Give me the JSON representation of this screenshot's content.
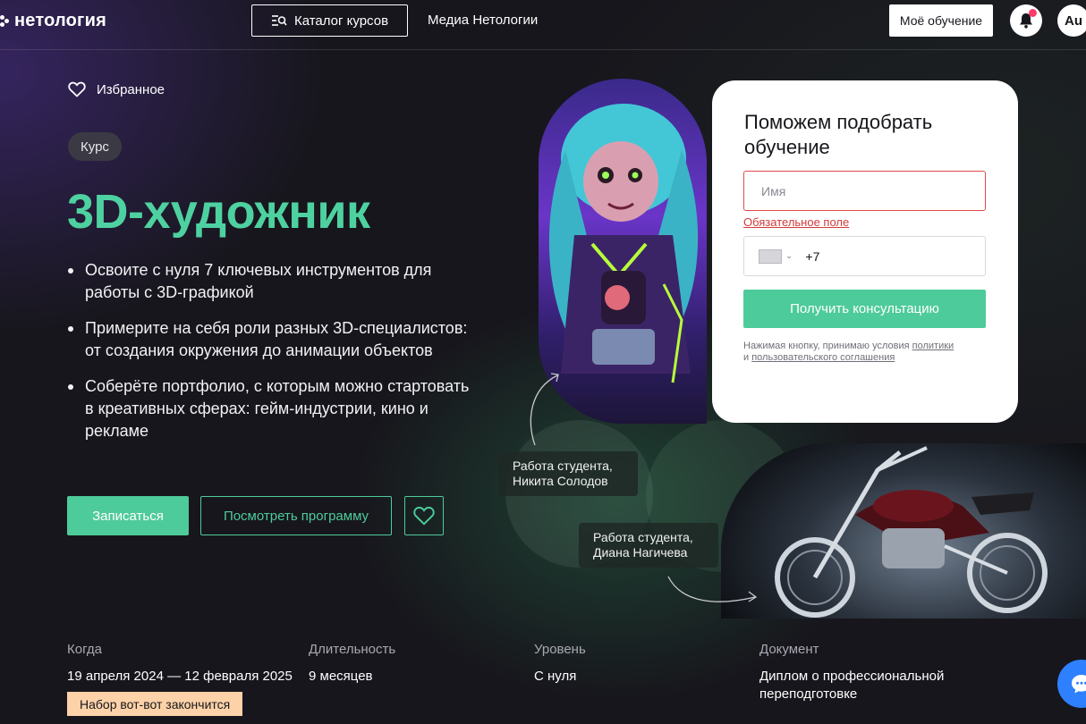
{
  "header": {
    "logo_text": "нетология",
    "catalog_label": "Каталог курсов",
    "media_label": "Медиа Нетологии",
    "my_learning_label": "Моё обучение",
    "avatar_initials": "Au"
  },
  "hero": {
    "favorites_label": "Избранное",
    "badge": "Курс",
    "title": "3D-художник",
    "bullets": [
      "Освоите с нуля 7 ключевых инструментов для работы с 3D-графикой",
      "Примерите на себя роли разных 3D-специалистов: от создания окружения до анимации объектов",
      "Соберёте портфолио, с которым можно стартовать в креативных сферах: гейм-индустрии, кино и рекламе"
    ],
    "enroll_label": "Записаться",
    "program_label": "Посмотреть программу"
  },
  "info": {
    "when_label": "Когда",
    "when_value": "19 апреля 2024 — 12 февраля 2025",
    "duration_label": "Длительность",
    "duration_value": "9 месяцев",
    "level_label": "Уровень",
    "level_value": "С нуля",
    "document_label": "Документ",
    "document_value": "Диплом о профессиональной переподготовке",
    "deadline_badge": "Набор вот-вот закончится"
  },
  "students": {
    "first": "Работа студента, Никита Солодов",
    "second": "Работа студента, Диана Нагичева"
  },
  "form": {
    "title": "Поможем подобрать обучение",
    "name_placeholder": "Имя",
    "name_value": "",
    "required_error": "Обязательное поле",
    "phone_code": "+7",
    "submit_label": "Получить консультацию",
    "terms_prefix": "Нажимая кнопку, принимаю условия ",
    "terms_policy_link": "политики",
    "terms_and": "и ",
    "terms_agreement_link": "пользовательского соглашения"
  },
  "colors": {
    "accent": "#4ecb9a",
    "title": "#4ed1a0",
    "error": "#e24a4a",
    "deadline_bg": "#fdd2a8",
    "chat": "#2f80ff"
  }
}
